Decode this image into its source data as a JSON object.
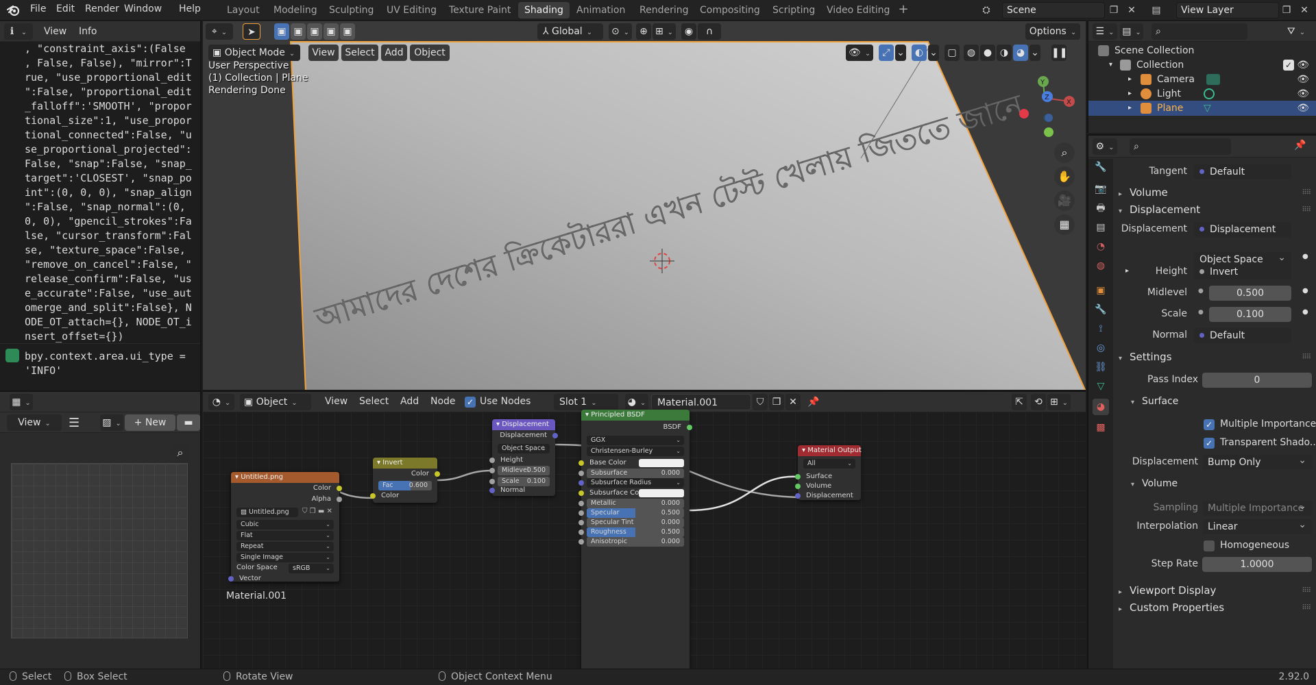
{
  "menu": [
    "File",
    "Edit",
    "Render",
    "Window",
    "Help"
  ],
  "workspaces": [
    "Layout",
    "Modeling",
    "Sculpting",
    "UV Editing",
    "Texture Paint",
    "Shading",
    "Animation",
    "Rendering",
    "Compositing",
    "Scripting",
    "Video Editing"
  ],
  "active_workspace": "Shading",
  "scene_name": "Scene",
  "view_layer": "View Layer",
  "info": {
    "menu_view": "View",
    "menu_info": "Info",
    "log_lines": [
      ", \"constraint_axis\":(False",
      ", False, False), \"mirror\":T",
      "rue, \"use_proportional_edit",
      "\":False, \"proportional_edit",
      "_falloff\":'SMOOTH', \"propor",
      "tional_size\":1, \"use_propor",
      "tional_connected\":False, \"u",
      "se_proportional_projected\":",
      "False, \"snap\":False, \"snap_",
      "target\":'CLOSEST', \"snap_po",
      "int\":(0, 0, 0), \"snap_align",
      "\":False, \"snap_normal\":(0,",
      "0, 0), \"gpencil_strokes\":Fa",
      "lse, \"cursor_transform\":Fal",
      "se, \"texture_space\":False,",
      "\"remove_on_cancel\":False, \"",
      "release_confirm\":False, \"us",
      "e_accurate\":False, \"use_aut",
      "omerge_and_split\":False}, N",
      "ODE_OT_attach={}, NODE_OT_i",
      "nsert_offset={})"
    ],
    "cmd_lines": [
      "bpy.context.area.ui_type =",
      "'INFO'"
    ]
  },
  "image_editor": {
    "view": "View",
    "new": "New"
  },
  "viewport": {
    "mode": "Object Mode",
    "menus": [
      "View",
      "Select",
      "Add",
      "Object"
    ],
    "orientation": "Global",
    "options": "Options",
    "overlay_lines": [
      "User Perspective",
      "(1) Collection | Plane",
      "Rendering Done"
    ],
    "bengali_text": "আমাদের দেশের ক্রিকেটাররা এখন টেস্ট খেলায় জিততে জানে"
  },
  "node_editor": {
    "type": "Object",
    "menus": [
      "View",
      "Select",
      "Add",
      "Node"
    ],
    "use_nodes": "Use Nodes",
    "slot": "Slot 1",
    "material": "Material.001",
    "material_label": "Material.001",
    "nodes": {
      "image": {
        "title": "Untitled.png",
        "out_color": "Color",
        "out_alpha": "Alpha",
        "image_name": "Untitled.png",
        "interp": "Cubic",
        "proj": "Flat",
        "ext": "Repeat",
        "source": "Single Image",
        "cs_label": "Color Space",
        "cs_value": "sRGB",
        "in_vector": "Vector"
      },
      "invert": {
        "title": "Invert",
        "out_color": "Color",
        "fac_label": "Fac",
        "fac_value": "0.600",
        "fac": 0.6,
        "in_color": "Color"
      },
      "displacement": {
        "title": "Displacement",
        "out": "Displacement",
        "space": "Object Space",
        "in_height": "Height",
        "midlevel_label": "Midlevel",
        "midlevel_value": "0.500",
        "scale_label": "Scale",
        "scale_value": "0.100",
        "in_normal": "Normal"
      },
      "bsdf": {
        "title": "Principled BSDF",
        "out": "BSDF",
        "distribution": "GGX",
        "sss_method": "Christensen-Burley",
        "base_color": "Base Color",
        "subsurface": "Subsurface",
        "subsurface_value": "0.000",
        "subsurface_radius": "Subsurface Radius",
        "subsurface_color": "Subsurface Color",
        "metallic": "Metallic",
        "metallic_value": "0.000",
        "specular": "Specular",
        "specular_value": "0.500",
        "specular_fill": 0.5,
        "specular_tint": "Specular Tint",
        "specular_tint_value": "0.000",
        "roughness": "Roughness",
        "roughness_value": "0.500",
        "roughness_fill": 0.5,
        "anisotropic": "Anisotropic",
        "anisotropic_value": "0.000"
      },
      "output": {
        "title": "Material Output",
        "target": "All",
        "in_surface": "Surface",
        "in_volume": "Volume",
        "in_displacement": "Displacement"
      }
    }
  },
  "outliner": {
    "scene_collection": "Scene Collection",
    "collection": "Collection",
    "items": [
      "Camera",
      "Light",
      "Plane"
    ]
  },
  "properties": {
    "tangent_label": "Tangent",
    "tangent_value": "Default",
    "sections": {
      "volume": "Volume",
      "displacement": "Displacement",
      "settings": "Settings",
      "surface": "Surface",
      "volume2": "Volume",
      "viewport_display": "Viewport Display",
      "custom_properties": "Custom Properties"
    },
    "disp_label": "Displacement",
    "disp_value": "Displacement",
    "space_value": "Object Space",
    "height_label": "Height",
    "height_value": "Invert",
    "midlevel_label": "Midlevel",
    "midlevel_value": "0.500",
    "scale_label": "Scale",
    "scale_value": "0.100",
    "normal_label": "Normal",
    "normal_value": "Default",
    "pass_index_label": "Pass Index",
    "pass_index_value": "0",
    "multiple_importance": "Multiple Importance",
    "transparent_shadows": "Transparent Shado...",
    "displacement_method_label": "Displacement",
    "displacement_method_value": "Bump Only",
    "sampling_label": "Sampling",
    "sampling_value": "Multiple Importance",
    "interpolation_label": "Interpolation",
    "interpolation_value": "Linear",
    "homogeneous": "Homogeneous",
    "step_rate_label": "Step Rate",
    "step_rate_value": "1.0000"
  },
  "statusbar": {
    "select": "Select",
    "box_select": "Box Select",
    "rotate_view": "Rotate View",
    "context_menu": "Object Context Menu",
    "version": "2.92.0"
  },
  "colors": {
    "accent": "#4772b3",
    "image_node": "#a45a2c",
    "invert_node": "#7c7a2a",
    "displacement_node": "#6b57c0",
    "bsdf_node": "#3c7a3c",
    "output_node": "#a02b30",
    "selection_outline": "#f2a23b"
  }
}
